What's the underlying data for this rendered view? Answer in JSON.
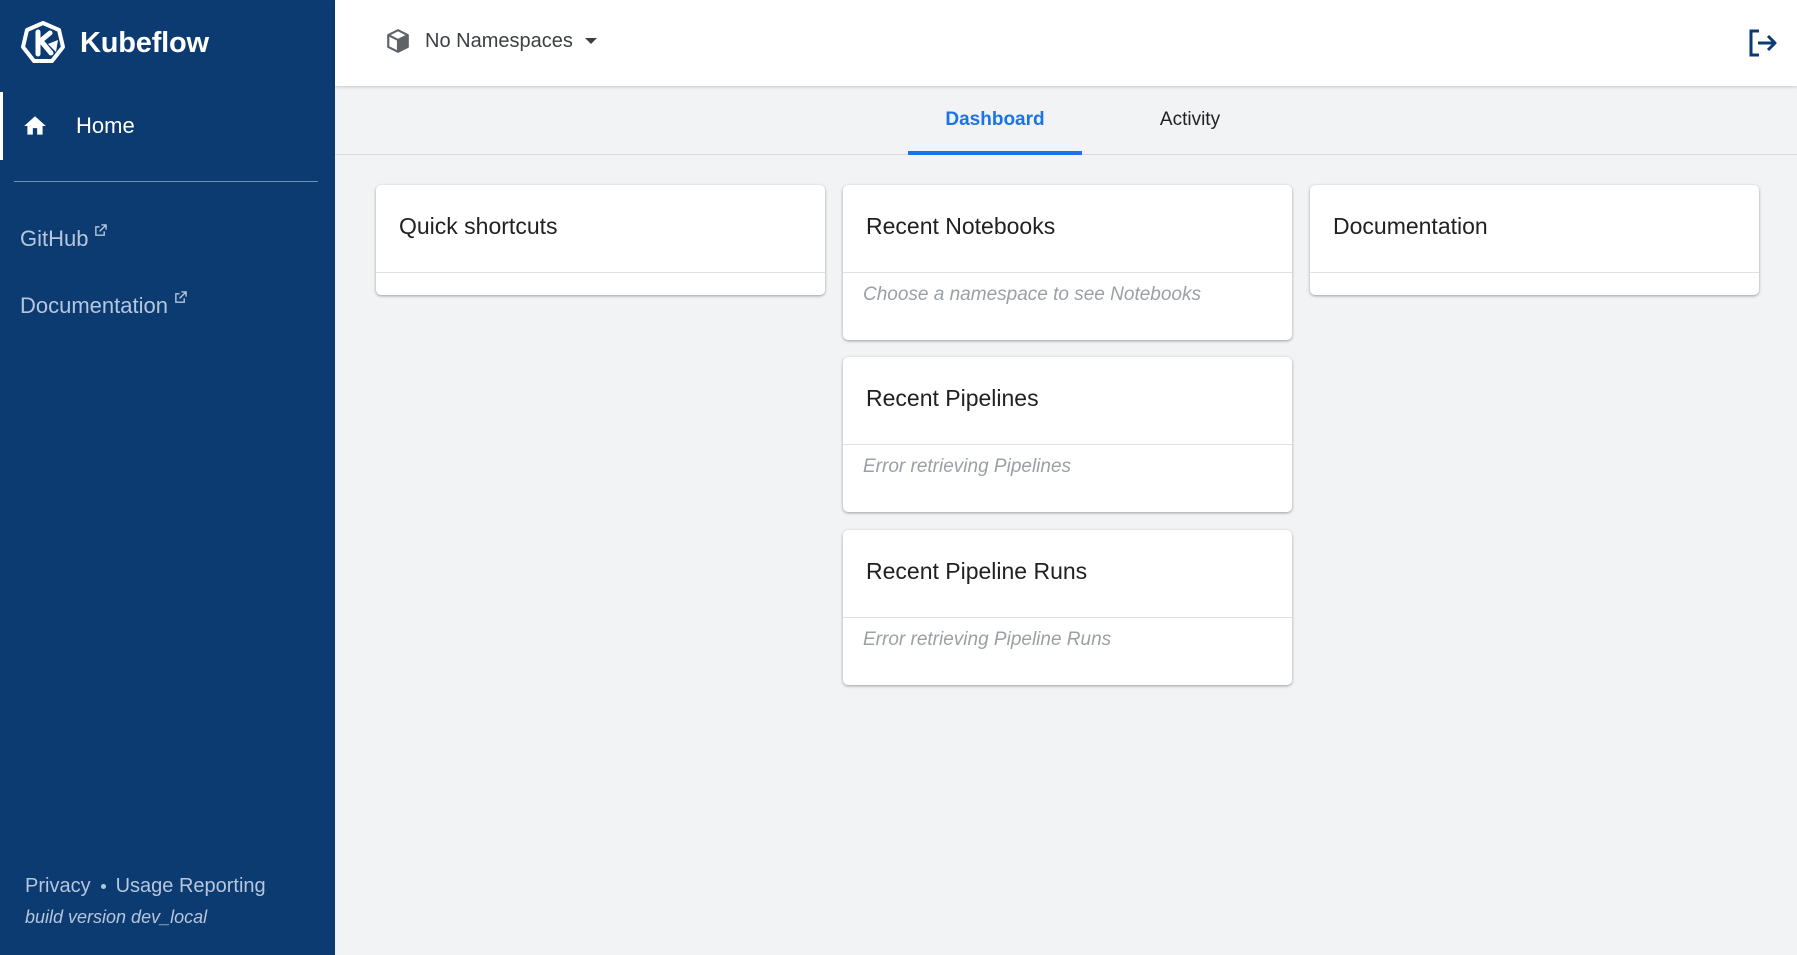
{
  "brand": {
    "name": "Kubeflow"
  },
  "sidebar": {
    "home_label": "Home",
    "links": [
      {
        "label": "GitHub"
      },
      {
        "label": "Documentation"
      }
    ],
    "footer": {
      "privacy": "Privacy",
      "usage": "Usage Reporting",
      "build": "build version dev_local"
    }
  },
  "topbar": {
    "namespace_label": "No Namespaces"
  },
  "tabs": [
    {
      "label": "Dashboard",
      "active": true
    },
    {
      "label": "Activity",
      "active": false
    }
  ],
  "cards": {
    "quick_shortcuts": {
      "title": "Quick shortcuts"
    },
    "recent_notebooks": {
      "title": "Recent Notebooks",
      "message": "Choose a namespace to see Notebooks"
    },
    "recent_pipelines": {
      "title": "Recent Pipelines",
      "message": "Error retrieving Pipelines"
    },
    "recent_runs": {
      "title": "Recent Pipeline Runs",
      "message": "Error retrieving Pipeline Runs"
    },
    "documentation": {
      "title": "Documentation"
    }
  },
  "colors": {
    "sidebar_bg": "#0b3b70",
    "accent": "#1a73e8",
    "page_bg": "#f1f3f4"
  }
}
